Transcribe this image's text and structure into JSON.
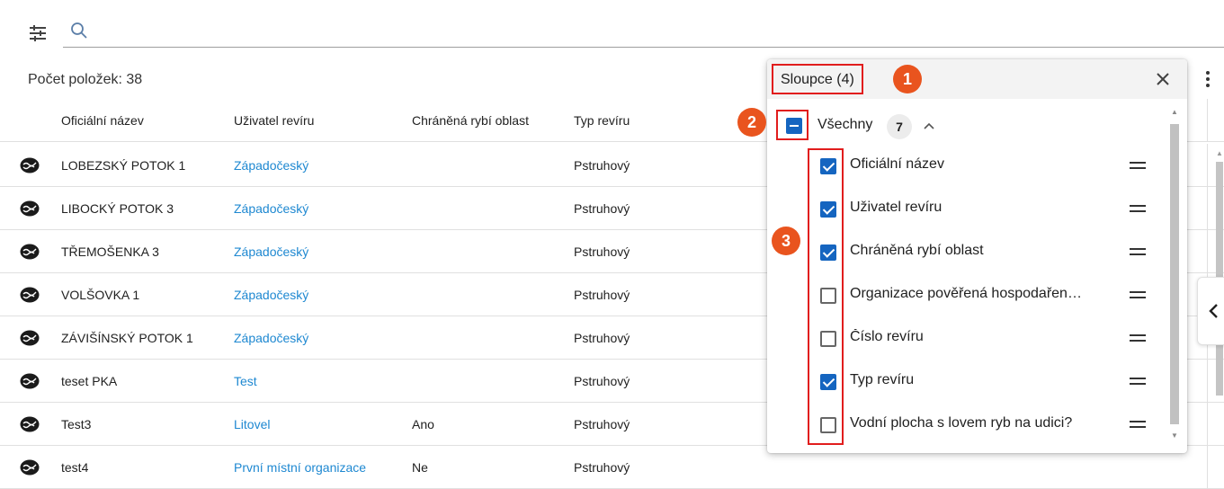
{
  "toolbar": {
    "search_placeholder": ""
  },
  "count_label": "Počet položek: 38",
  "table": {
    "headers": [
      "Oficiální název",
      "Uživatel revíru",
      "Chráněná rybí oblast",
      "Typ revíru"
    ],
    "rows": [
      {
        "name": "LOBEZSKÝ POTOK 1",
        "user": "Západočeský",
        "protected": "",
        "type": "Pstruhový"
      },
      {
        "name": "LIBOCKÝ POTOK 3",
        "user": "Západočeský",
        "protected": "",
        "type": "Pstruhový"
      },
      {
        "name": "TŘEMOŠENKA 3",
        "user": "Západočeský",
        "protected": "",
        "type": "Pstruhový"
      },
      {
        "name": "VOLŠOVKA 1",
        "user": "Západočeský",
        "protected": "",
        "type": "Pstruhový"
      },
      {
        "name": "ZÁVIŠÍNSKÝ POTOK 1",
        "user": "Západočeský",
        "protected": "",
        "type": "Pstruhový"
      },
      {
        "name": "teset PKA",
        "user": "Test",
        "protected": "",
        "type": "Pstruhový"
      },
      {
        "name": "Test3",
        "user": "Litovel",
        "protected": "Ano",
        "type": "Pstruhový"
      },
      {
        "name": "test4",
        "user": "První místní organizace",
        "protected": "Ne",
        "type": "Pstruhový"
      }
    ]
  },
  "columns_panel": {
    "title": "Sloupce (4)",
    "all_label": "Všechny",
    "all_count": "7",
    "items": [
      {
        "label": "Oficiální název",
        "checked": true
      },
      {
        "label": "Uživatel revíru",
        "checked": true
      },
      {
        "label": "Chráněná rybí oblast",
        "checked": true
      },
      {
        "label": "Organizace pověřená hospodařen…",
        "checked": false
      },
      {
        "label": "Číslo revíru",
        "checked": false
      },
      {
        "label": "Typ revíru",
        "checked": true
      },
      {
        "label": "Vodní plocha s lovem ryb na udici?",
        "checked": false
      }
    ]
  },
  "annotations": {
    "badge1": "1",
    "badge2": "2",
    "badge3": "3"
  },
  "colors": {
    "accent": "#1565c0",
    "link": "#1e88d1",
    "annotation_red": "#e11d1d",
    "badge_orange": "#e9541e"
  }
}
